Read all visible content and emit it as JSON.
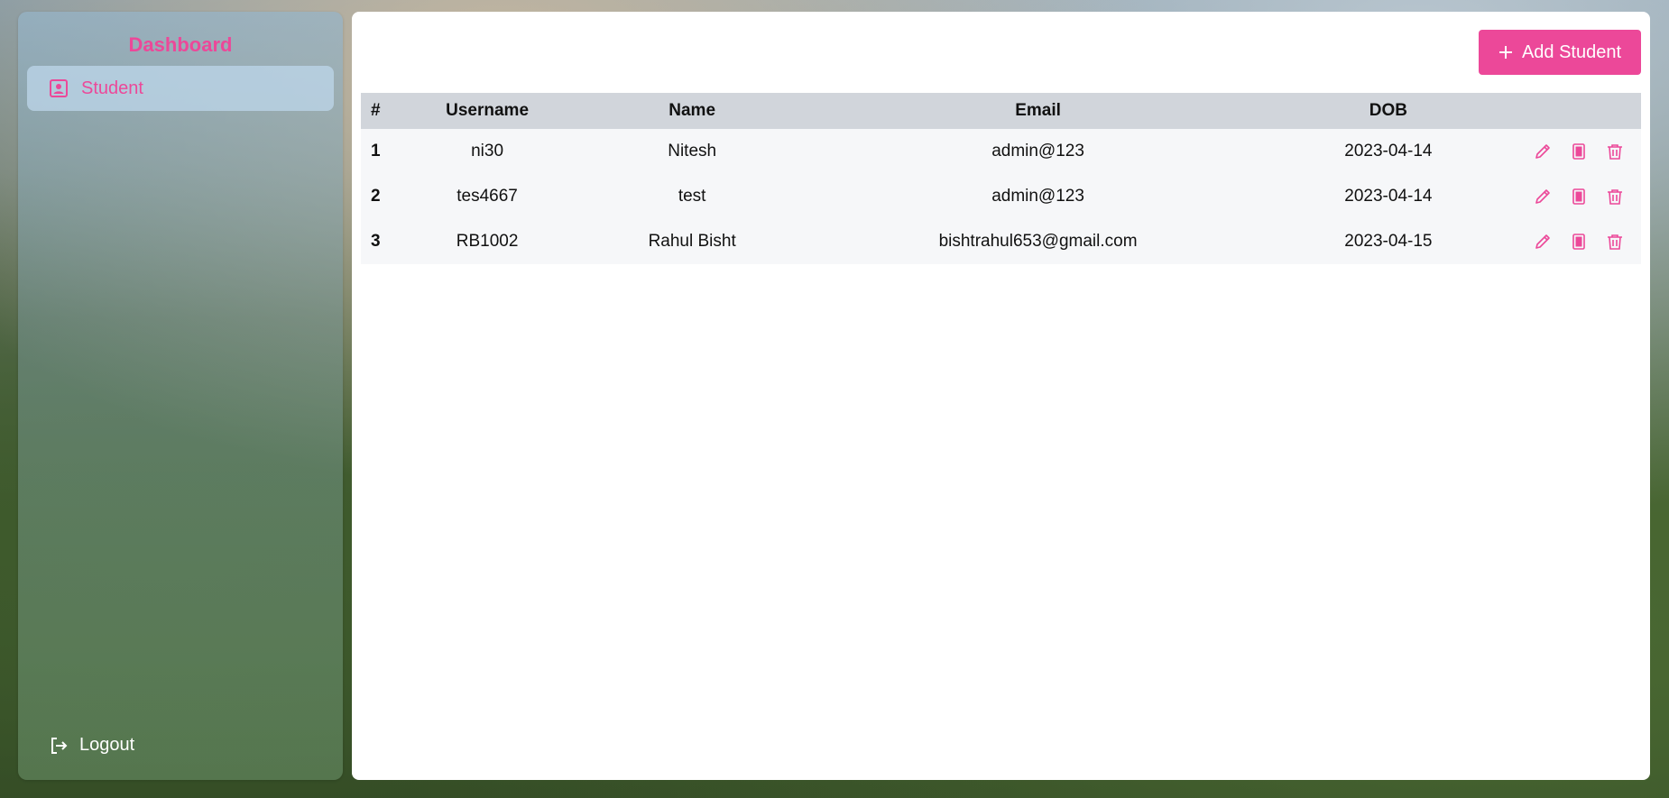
{
  "sidebar": {
    "brand": "Dashboard",
    "items": [
      {
        "label": "Student",
        "icon": "user-card-icon"
      }
    ],
    "logout_label": "Logout"
  },
  "toolbar": {
    "add_label": "Add Student"
  },
  "table": {
    "headers": [
      "#",
      "Username",
      "Name",
      "Email",
      "DOB"
    ],
    "rows": [
      {
        "num": "1",
        "username": "ni30",
        "name": "Nitesh",
        "email": "admin@123",
        "dob": "2023-04-14"
      },
      {
        "num": "2",
        "username": "tes4667",
        "name": "test",
        "email": "admin@123",
        "dob": "2023-04-14"
      },
      {
        "num": "3",
        "username": "RB1002",
        "name": "Rahul Bisht",
        "email": "bishtrahul653@gmail.com",
        "dob": "2023-04-15"
      }
    ]
  },
  "colors": {
    "accent": "#ec4899",
    "header_bg": "#d1d5db",
    "row_bg": "#f6f7f9"
  }
}
